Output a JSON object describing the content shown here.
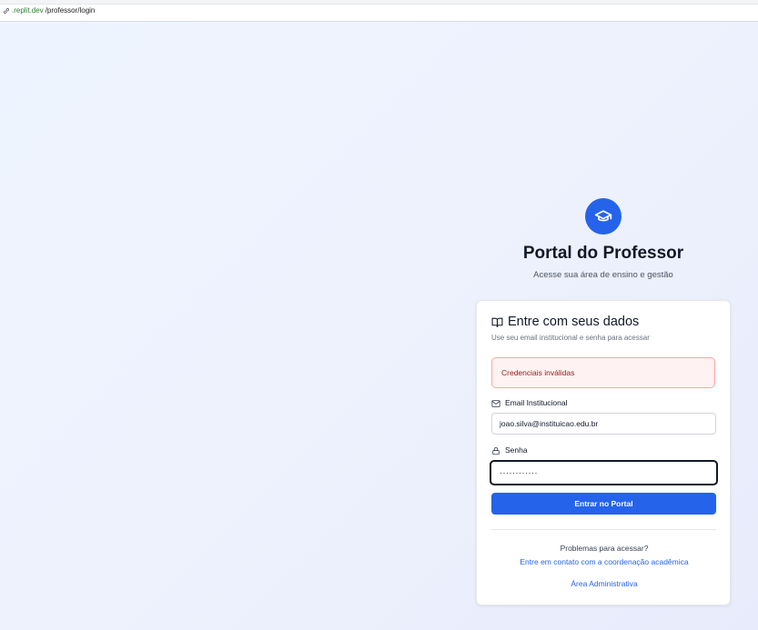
{
  "browser": {
    "url_host": ".replit.dev",
    "url_path": "/professor/login"
  },
  "header": {
    "logo_icon": "graduation-cap-icon",
    "title": "Portal do Professor",
    "subtitle": "Acesse sua área de ensino e gestão"
  },
  "login_card": {
    "title_icon": "book-open-icon",
    "title": "Entre com seus dados",
    "description": "Use seu email institucional e senha para acessar",
    "error_message": "Credenciais inválidas",
    "email": {
      "icon": "mail-icon",
      "label": "Email Institucional",
      "value": "joao.silva@instituicao.edu.br"
    },
    "password": {
      "icon": "lock-icon",
      "label": "Senha",
      "value": "············"
    },
    "submit_label": "Entrar no Portal",
    "help_text": "Problemas para acessar?",
    "help_link": "Entre em contato com a coordenação acadêmica",
    "admin_link": "Área Administrativa"
  },
  "colors": {
    "primary": "#2563eb",
    "error_bg": "#fef2f2",
    "error_text": "#991b1b"
  }
}
